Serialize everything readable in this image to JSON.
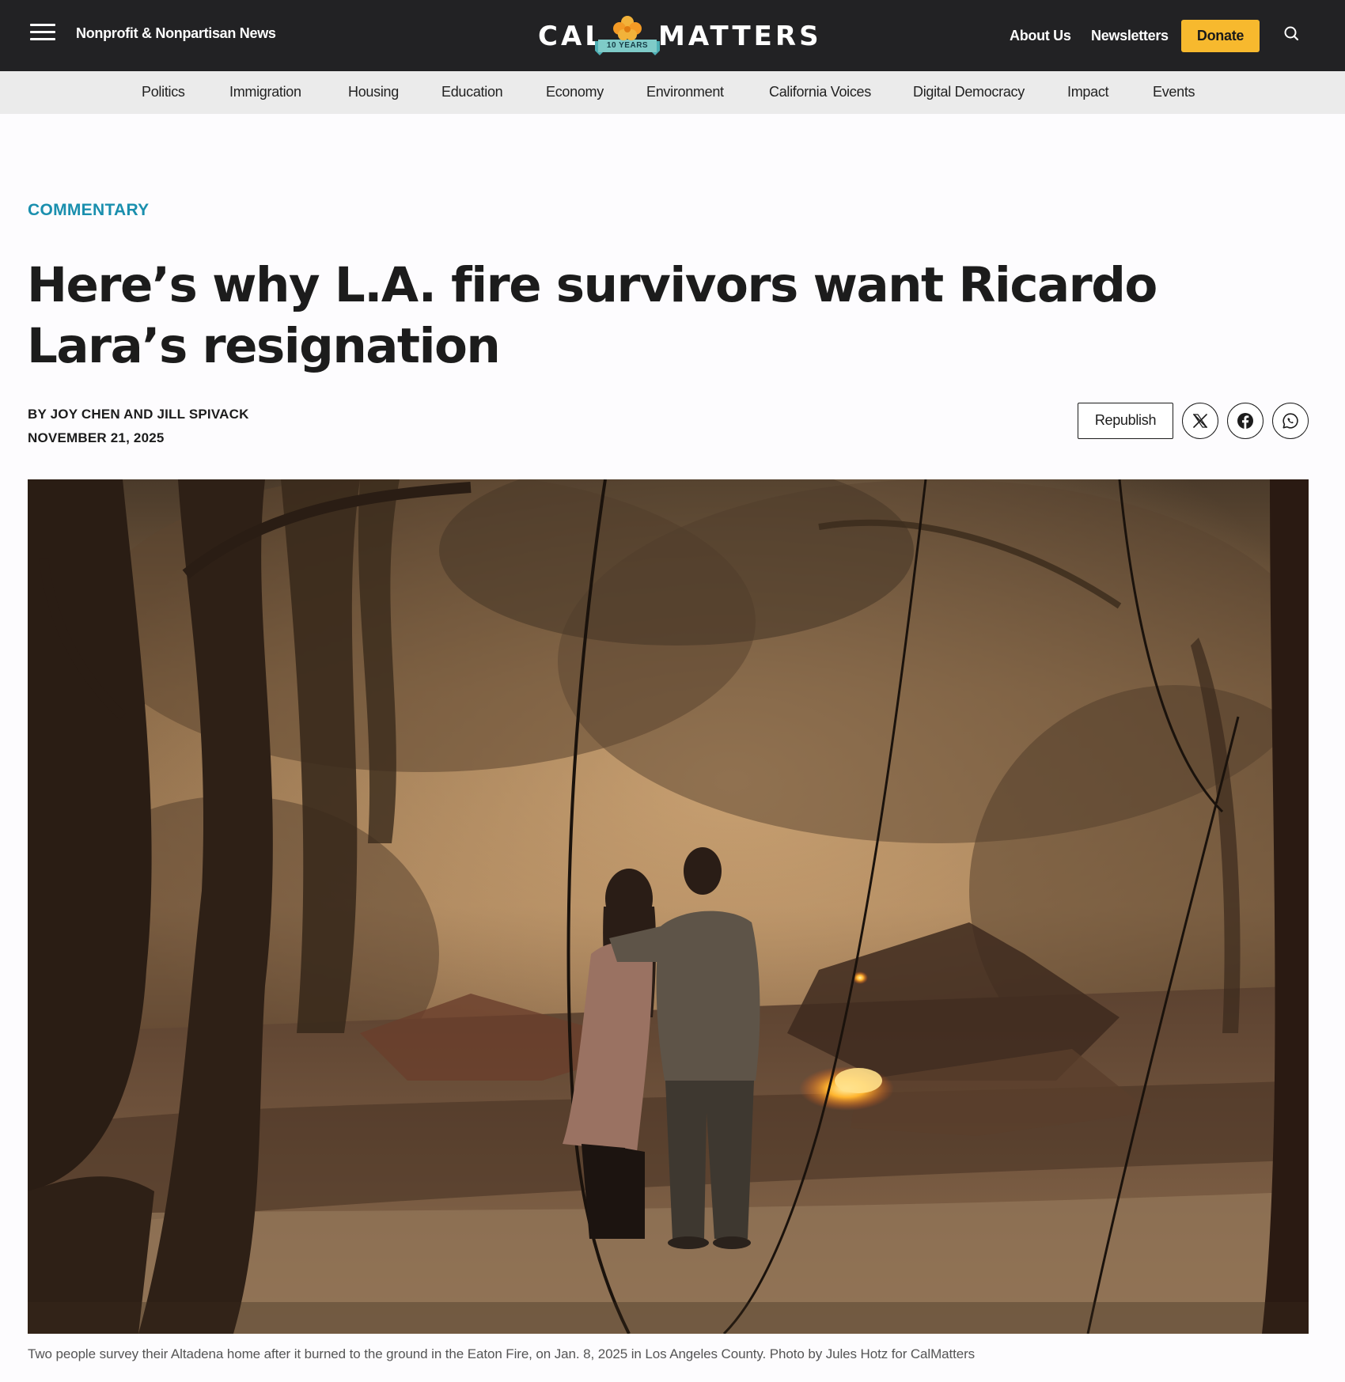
{
  "header": {
    "menu_icon": "hamburger-icon",
    "tagline": "Nonprofit & Nonpartisan News",
    "logo": {
      "left": "CAL",
      "right": "MATTERS",
      "badge": "10 YEARS"
    },
    "links": [
      {
        "label": "About Us"
      },
      {
        "label": "Newsletters"
      }
    ],
    "donate_label": "Donate",
    "search_icon": "search-icon",
    "accent_color": "#f7b92e"
  },
  "sections": [
    "Politics",
    "Immigration",
    "Housing",
    "Education",
    "Economy",
    "Environment",
    "California Voices",
    "Digital Democracy",
    "Impact",
    "Events"
  ],
  "article": {
    "kicker": "COMMENTARY",
    "kicker_color": "#1a8fae",
    "headline": "Here’s why L.A. fire survivors want Ricardo Lara’s resignation",
    "byline": "BY JOY CHEN AND JILL SPIVACK",
    "date": "NOVEMBER 21, 2025",
    "republish_label": "Republish",
    "share_icons": [
      "x-icon",
      "facebook-icon",
      "whatsapp-icon"
    ],
    "caption": "Two people survey their Altadena home after it burned to the ground in the Eaton Fire, on Jan. 8, 2025 in Los Angeles County. Photo by Jules Hotz for CalMatters"
  }
}
